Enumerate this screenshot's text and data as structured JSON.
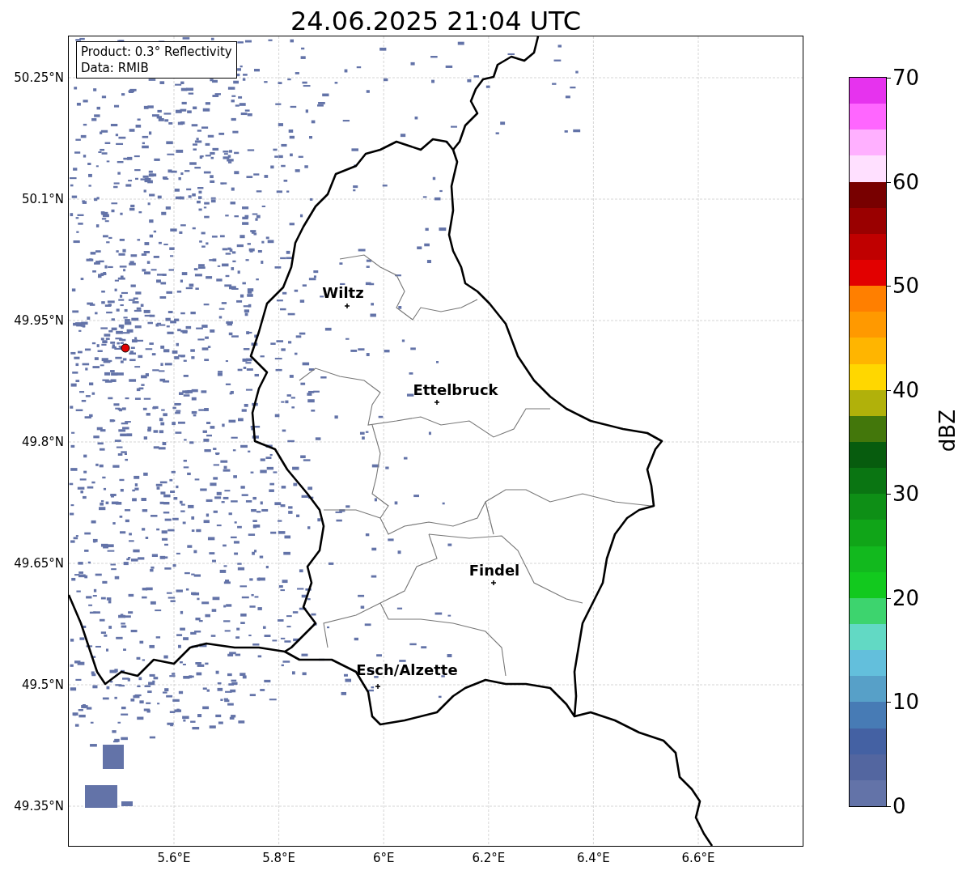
{
  "title": "24.06.2025 21:04 UTC",
  "legend": {
    "lines": [
      "Product: 0.3° Reflectivity",
      "Data: RMIB"
    ]
  },
  "map": {
    "yticks": [
      "50.25°N",
      "50.1°N",
      "49.95°N",
      "49.8°N",
      "49.65°N",
      "49.5°N",
      "49.35°N"
    ],
    "xticks": [
      "5.6°E",
      "5.8°E",
      "6°E",
      "6.2°E",
      "6.4°E",
      "6.6°E"
    ],
    "cities": [
      {
        "name": "Wiltz"
      },
      {
        "name": "Ettelbruck"
      },
      {
        "name": "Findel"
      },
      {
        "name": "Esch/Alzette"
      }
    ]
  },
  "colorbar": {
    "label": "dBZ",
    "ticks": [
      "70",
      "60",
      "50",
      "40",
      "30",
      "20",
      "10",
      "0"
    ],
    "segments": [
      {
        "color": "#e633ee"
      },
      {
        "color": "#ff66ff"
      },
      {
        "color": "#ffb0ff"
      },
      {
        "color": "#ffe0ff"
      },
      {
        "color": "#780000"
      },
      {
        "color": "#9a0000"
      },
      {
        "color": "#c00000"
      },
      {
        "color": "#e20000"
      },
      {
        "color": "#ff7f00"
      },
      {
        "color": "#ff9900"
      },
      {
        "color": "#ffb500"
      },
      {
        "color": "#ffd700"
      },
      {
        "color": "#b1b10a"
      },
      {
        "color": "#43770b"
      },
      {
        "color": "#075c0e"
      },
      {
        "color": "#0a7512"
      },
      {
        "color": "#0e8f16"
      },
      {
        "color": "#10a518"
      },
      {
        "color": "#12b91e"
      },
      {
        "color": "#12c91e"
      },
      {
        "color": "#3dd46e"
      },
      {
        "color": "#62d9c4"
      },
      {
        "color": "#63bfdc"
      },
      {
        "color": "#57a0c8"
      },
      {
        "color": "#477bb5"
      },
      {
        "color": "#4461a3"
      },
      {
        "color": "#5366a0"
      },
      {
        "color": "#6373a8"
      }
    ]
  }
}
